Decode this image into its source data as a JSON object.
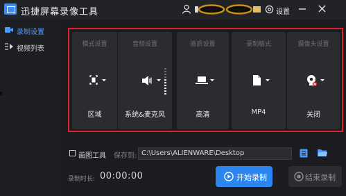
{
  "app": {
    "title": "迅捷屏幕录像工具"
  },
  "header": {
    "settings_label": "设置"
  },
  "sidebar": {
    "items": [
      {
        "label": "录制设置",
        "icon": "video-camera-icon",
        "active": true
      },
      {
        "label": "视频列表",
        "icon": "video-list-icon",
        "active": false
      }
    ]
  },
  "settings": {
    "columns": [
      {
        "heading": "模式设置",
        "value": "区域",
        "icon": "region-select-icon"
      },
      {
        "heading": "音频设置",
        "value": "系统&麦克风",
        "icon": "speaker-icon"
      },
      {
        "heading": "画质设置",
        "value": "高清",
        "icon": "laptop-icon"
      },
      {
        "heading": "录制格式",
        "value": "MP4",
        "icon": "file-icon"
      },
      {
        "heading": "摄像头设置",
        "value": "关闭",
        "icon": "webcam-off-icon"
      }
    ]
  },
  "bottom": {
    "draw_tool_label": "画图工具",
    "save_to_label": "保存到:",
    "save_path": "C:\\Users\\ALIENWARE\\Desktop",
    "duration_label": "录制时长:",
    "duration_value": "00:00:00",
    "start_label": "开始录制",
    "stop_label": "结束录制"
  },
  "colors": {
    "accent": "#2b87ef",
    "highlight_border": "#e0202a",
    "background": "#1b1c20"
  }
}
